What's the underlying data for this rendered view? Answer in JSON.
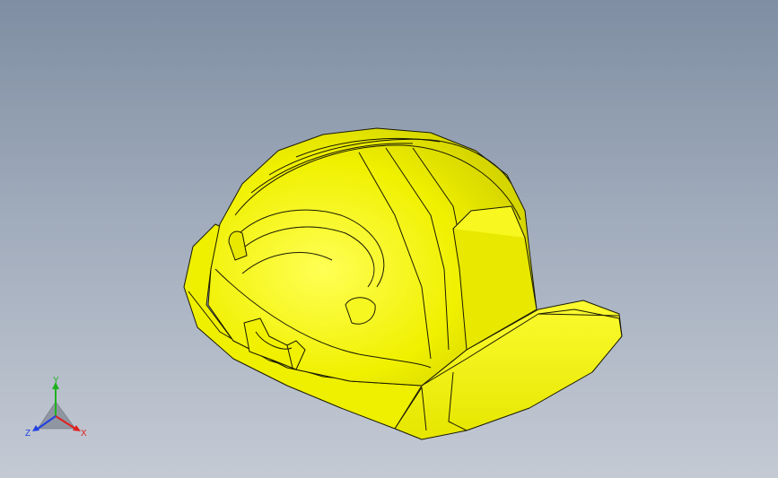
{
  "viewport": {
    "background_top": "#7f8ea3",
    "background_bottom": "#c4cad4"
  },
  "model": {
    "object": "safety helmet",
    "color": "#f2f200",
    "edge_color": "#1a1a00"
  },
  "triad": {
    "x_label": "X",
    "y_label": "Y",
    "z_label": "Z",
    "x_color": "#e02020",
    "y_color": "#20b020",
    "z_color": "#2040e0"
  }
}
